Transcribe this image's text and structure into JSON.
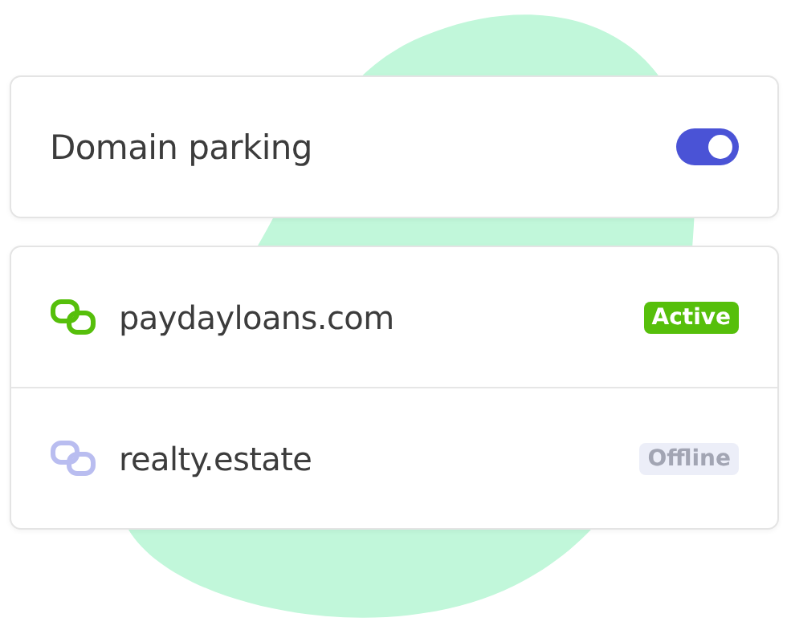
{
  "setting": {
    "label": "Domain parking",
    "on": true
  },
  "domains": [
    {
      "name": "paydayloans.com",
      "status": {
        "kind": "active",
        "label": "Active"
      }
    },
    {
      "name": "realty.estate",
      "status": {
        "kind": "offline",
        "label": "Offline"
      }
    }
  ]
}
